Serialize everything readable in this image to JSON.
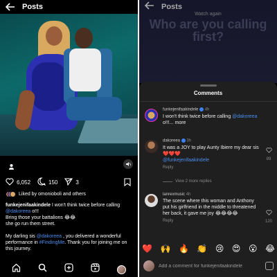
{
  "left": {
    "header": {
      "title": "Posts"
    },
    "actions": {
      "likes": "6,052",
      "comments": "150",
      "shares": "3"
    },
    "liked_by": "Liked by omonioboli and others",
    "caption": {
      "user": "funkejenifaakindele",
      "line1": " I won't think twice before calling ",
      "mention1": "@dakoreea",
      "line1_end": " o!!!",
      "line2": "Bring those your battalions 😂😂",
      "line3": "she go run them street.",
      "line4a": "My darling sis ",
      "mention2": "@dakoreea",
      "line4b": " , you delivered a wonderful performance in ",
      "hashtag": "#FindingMe",
      "line4c": ". Thank you for joining me on this journey."
    }
  },
  "right": {
    "header": {
      "title": "Posts"
    },
    "video_overlay": {
      "small": "Watch again",
      "big": "Who are you calling first?"
    },
    "sheet_title": "Comments",
    "comments": [
      {
        "user": "funkejenifaakindele",
        "time": "4h",
        "text_a": "I won't think twice before calling ",
        "mention": "@dakoreea",
        "text_b": " o!!!... more",
        "reply": ""
      },
      {
        "user": "dakoreea",
        "time": "3h",
        "text_a": "It was a JOY to play Aunty Ibiere my dear sis ❤️❤️❤️",
        "mention": "@funkejenifaakindele",
        "text_b": "",
        "reply": "Reply",
        "likes": "89"
      },
      {
        "user": "lanrexmusic",
        "time": "4h",
        "text_a": "The scene where this woman and Anthony put his girlfriend in the middle to threatened her back, it gave me joy 😂😂😂😂",
        "mention": "",
        "text_b": "",
        "reply": "Reply",
        "likes": "120"
      }
    ],
    "view_replies": "View 2 more replies",
    "emojis": [
      "❤️",
      "🙌",
      "🔥",
      "👏",
      "😢",
      "😍",
      "😮",
      "😂"
    ],
    "composer_placeholder": "Add a comment for funkejenifaakindele"
  }
}
